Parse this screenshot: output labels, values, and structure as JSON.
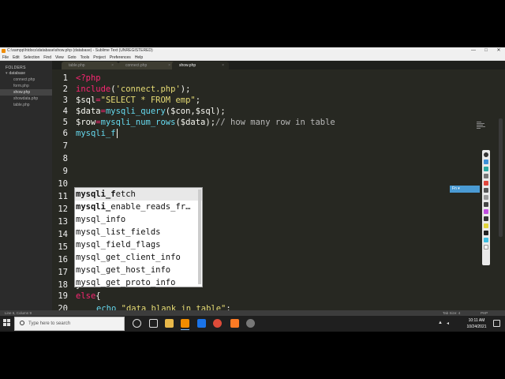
{
  "window": {
    "title": "C:\\xampp\\htdocs\\database\\show.php (database) - Sublime Text (UNREGISTERED)",
    "controls": [
      "—",
      "□",
      "✕"
    ]
  },
  "menu": [
    "File",
    "Edit",
    "Selection",
    "Find",
    "View",
    "Goto",
    "Tools",
    "Project",
    "Preferences",
    "Help"
  ],
  "sidebar": {
    "header": "FOLDERS",
    "folder": "database",
    "files": [
      "connect.php",
      "form.php",
      "show.php",
      "showdata.php",
      "table.php"
    ],
    "active_file": "show.php"
  },
  "tabs": [
    {
      "label": "table.php",
      "close": "×"
    },
    {
      "label": "connect.php",
      "close": "×"
    },
    {
      "label": "show.php",
      "close": "×"
    }
  ],
  "editor": {
    "line_numbers": [
      "1",
      "2",
      "3",
      "4",
      "5",
      "6",
      "7",
      "8",
      "9",
      "10",
      "11",
      "12",
      "13",
      "14",
      "15",
      "16",
      "17",
      "18",
      "19",
      "20"
    ],
    "lines": {
      "l1": "<?php",
      "l2_fn": "include",
      "l2_a": "(",
      "l2_str": "'connect.php'",
      "l2_b": ");",
      "l3_a": "$sql",
      "l3_op": "=",
      "l3_str": "\"SELECT * FROM emp\"",
      "l3_b": ";",
      "l4_a": "$data",
      "l4_op": "=",
      "l4_fn": "mysqli_query",
      "l4_b": "($con,$sql);",
      "l5_a": "$row",
      "l5_op": "=",
      "l5_fn": "mysqli_num_rows",
      "l5_b": "($data);",
      "l5_cm": "// how many row in table",
      "l6": "mysqli_f",
      "l17": "}",
      "l18_kw": "else",
      "l18_b": "{",
      "l19_kw": "echo",
      "l19_str": "\"data blank in table\"",
      "l19_b": ";",
      "l20": "}"
    }
  },
  "autocomplete": [
    {
      "prefix": "mysqli_f",
      "rest": "etch"
    },
    {
      "prefix": "mysqli_",
      "rest": "enable_reads_fr…"
    },
    {
      "prefix": "mysql_",
      "rest": "info"
    },
    {
      "prefix": "mysql_",
      "rest": "list_fields"
    },
    {
      "prefix": "mysql_",
      "rest": "field_flags"
    },
    {
      "prefix": "mysql_",
      "rest": "get_client_info"
    },
    {
      "prefix": "mysql_",
      "rest": "get_host_info"
    },
    {
      "prefix": "mysql_",
      "rest": "get_proto_info"
    }
  ],
  "popup_hint": "Fn ▾",
  "statusbar": {
    "position": "Line 6, Column 9",
    "tab_size": "Tab Size: 4",
    "syntax": "PHP"
  },
  "taskbar": {
    "search_placeholder": "Type here to search",
    "time": "10:11 AM",
    "date": "10/24/2021"
  },
  "colors": {
    "editor_bg": "#272822",
    "keyword": "#f92672",
    "string": "#e6db74",
    "function": "#66d9ef"
  }
}
